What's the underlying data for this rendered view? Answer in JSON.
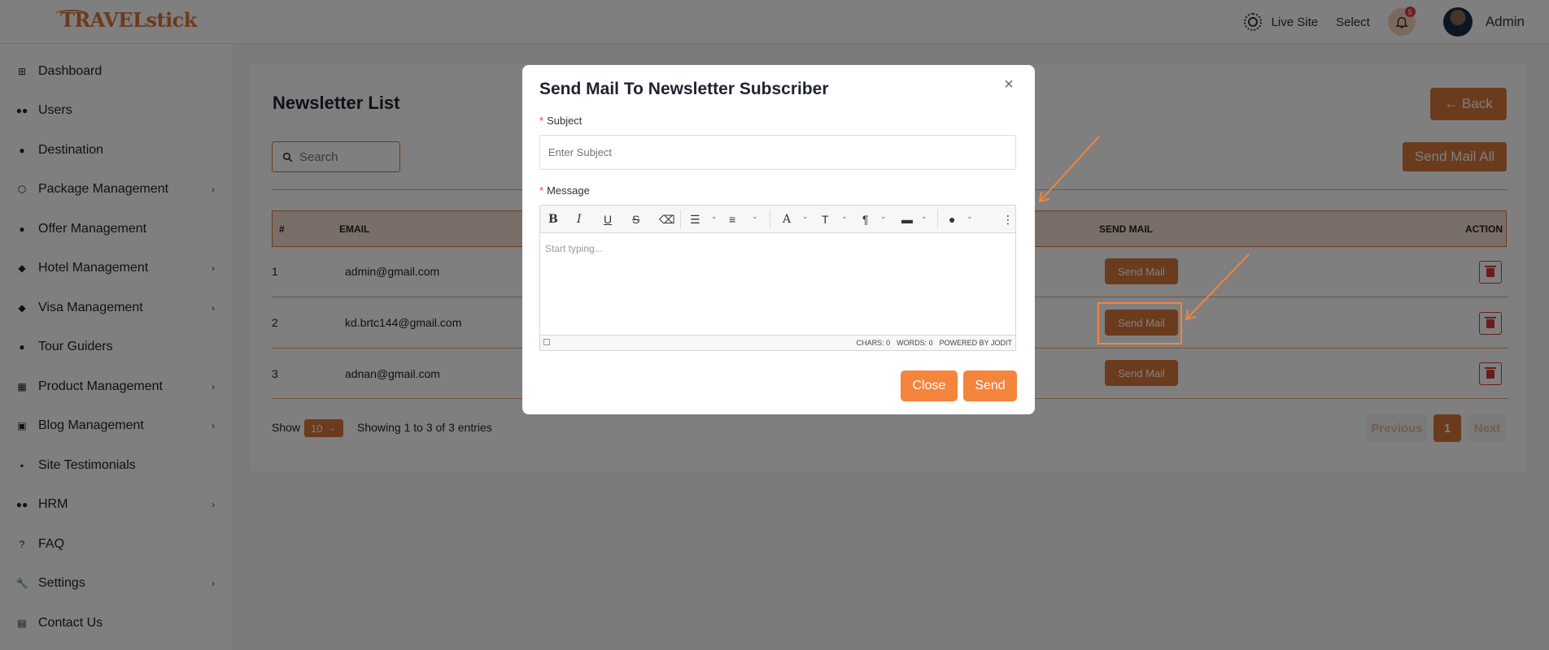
{
  "header": {
    "logo_text": "TRAVELstick",
    "live_site_label": "Live Site",
    "select_label": "Select",
    "notification_count": "5",
    "user_name": "Admin"
  },
  "sidebar": {
    "items": [
      {
        "label": "Dashboard",
        "icon": "dashboard-icon",
        "has_submenu": false
      },
      {
        "label": "Users",
        "icon": "users-icon",
        "has_submenu": false
      },
      {
        "label": "Destination",
        "icon": "map-pin-icon",
        "has_submenu": false
      },
      {
        "label": "Package Management",
        "icon": "box-icon",
        "has_submenu": true
      },
      {
        "label": "Offer Management",
        "icon": "offer-icon",
        "has_submenu": false
      },
      {
        "label": "Hotel Management",
        "icon": "hotel-icon",
        "has_submenu": true
      },
      {
        "label": "Visa Management",
        "icon": "visa-icon",
        "has_submenu": true
      },
      {
        "label": "Tour Guiders",
        "icon": "person-icon",
        "has_submenu": false
      },
      {
        "label": "Product Management",
        "icon": "grid-icon",
        "has_submenu": true
      },
      {
        "label": "Blog Management",
        "icon": "blog-icon",
        "has_submenu": true
      },
      {
        "label": "Site Testimonials",
        "icon": "message-icon",
        "has_submenu": false
      },
      {
        "label": "HRM",
        "icon": "team-icon",
        "has_submenu": true
      },
      {
        "label": "FAQ",
        "icon": "question-icon",
        "has_submenu": false
      },
      {
        "label": "Settings",
        "icon": "wrench-icon",
        "has_submenu": true
      },
      {
        "label": "Contact Us",
        "icon": "contact-card-icon",
        "has_submenu": false
      }
    ]
  },
  "main": {
    "title": "Newsletter List",
    "back_label": "← Back",
    "search_placeholder": "Search",
    "send_mail_all_label": "Send Mail All",
    "columns": [
      "#",
      "EMAIL",
      "SEND MAIL",
      "ACTION"
    ],
    "rows": [
      {
        "num": "1",
        "email": "admin@gmail.com",
        "send_label": "Send Mail"
      },
      {
        "num": "2",
        "email": "kd.brtc144@gmail.com",
        "send_label": "Send Mail"
      },
      {
        "num": "3",
        "email": "adnan@gmail.com",
        "send_label": "Send Mail"
      }
    ],
    "show_label": "Show",
    "page_size": "10",
    "entries_text": "Showing 1 to 3 of 3 entries",
    "pagination": {
      "previous": "Previous",
      "current": "1",
      "next": "Next"
    }
  },
  "modal": {
    "title": "Send Mail To Newsletter Subscriber",
    "close_icon": "×",
    "subject_label": "Subject",
    "subject_placeholder": "Enter Subject",
    "message_label": "Message",
    "required_mark": "*",
    "editor_placeholder": "Start typing...",
    "status_chars": "CHARS: 0",
    "status_words": "WORDS: 0",
    "status_powered": "POWERED BY JODIT",
    "close_button": "Close",
    "send_button": "Send"
  },
  "colors": {
    "accent": "#d7773d",
    "button": "#f5843c",
    "annotation": "#f5843c"
  }
}
